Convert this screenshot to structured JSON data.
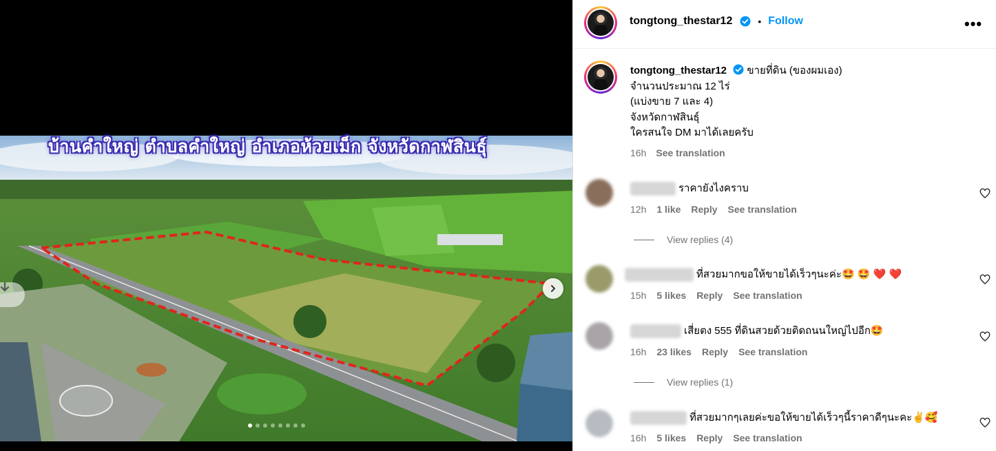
{
  "media": {
    "overlay_caption": "บ้านคำใหญ่ ตำบลคำใหญ่ อำเภอห้วยเม็ก จังหวัดกาฬสินธุ์",
    "carousel_slides": 8,
    "carousel_active": 1
  },
  "header": {
    "username": "tongtong_thestar12",
    "dot": "•",
    "follow_label": "Follow",
    "more_label": "•••"
  },
  "post": {
    "username": "tongtong_thestar12",
    "lines": [
      "ขายที่ดิน (ของผมเอง)",
      "จำนวนประมาณ 12 ไร่",
      "(แบ่งขาย 7 และ 4)",
      "จังหวัดกาฬสินธุ์",
      "ใครสนใจ DM มาได้เลยครับ"
    ],
    "time": "16h",
    "see_translation": "See translation"
  },
  "comments": [
    {
      "text": "ราคายังไงคราบ",
      "time": "12h",
      "likes": "1 like",
      "reply": "Reply",
      "see_translation": "See translation",
      "view_replies": "View replies (4)"
    },
    {
      "text": "ที่สวยมากขอให้ขายได้เร็วๆนะค่ะ🤩 🤩 ❤️ ❤️",
      "time": "15h",
      "likes": "5 likes",
      "reply": "Reply",
      "see_translation": "See translation",
      "view_replies": ""
    },
    {
      "text": "เสี่ยตง 555 ที่ดินสวยด้วยติดถนนใหญ่ไปอีก🤩",
      "time": "16h",
      "likes": "23 likes",
      "reply": "Reply",
      "see_translation": "See translation",
      "view_replies": "View replies (1)"
    },
    {
      "text": "ที่สวยมากๆเลยค่ะขอให้ขายได้เร็วๆนี้ราคาดีๆนะคะ✌️🥰",
      "time": "16h",
      "likes": "5 likes",
      "reply": "Reply",
      "see_translation": "See translation",
      "view_replies": ""
    }
  ],
  "colors": {
    "link_blue": "#0095f6",
    "secondary_text": "#737373",
    "border": "#dbdbdb",
    "overlay_text_outline": "#3b2fb0",
    "boundary_dash": "#e0251b"
  },
  "icons": [
    "download-icon",
    "chevron-right-icon",
    "verified-badge-icon",
    "more-options-icon",
    "heart-icon"
  ]
}
